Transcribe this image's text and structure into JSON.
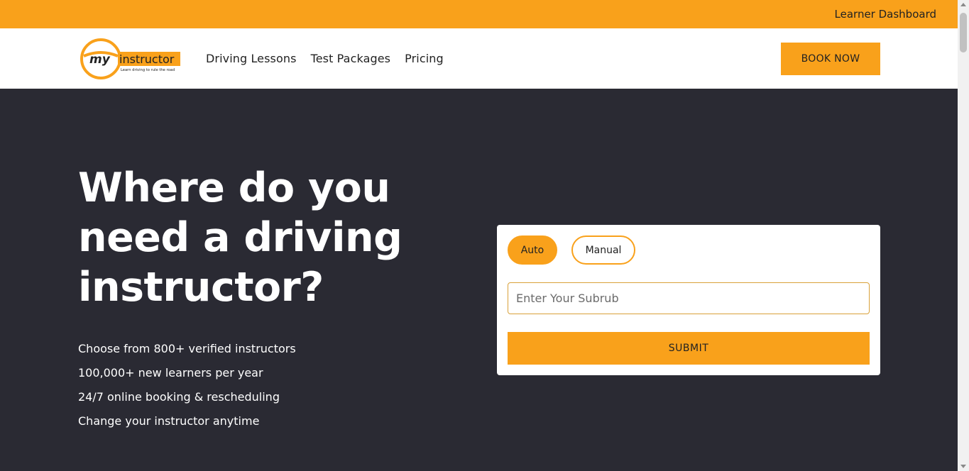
{
  "topbar": {
    "dashboard_link": "Learner Dashboard"
  },
  "brand": {
    "logo_my": "my",
    "logo_name": "instructor",
    "logo_tagline": "Learn driving to rule the road"
  },
  "nav": {
    "items": [
      {
        "label": "Driving Lessons"
      },
      {
        "label": "Test Packages"
      },
      {
        "label": "Pricing"
      }
    ],
    "book_now": "BOOK NOW"
  },
  "hero": {
    "heading": "Where do you need a driving instructor?",
    "features": [
      "Choose from 800+ verified instructors",
      "100,000+ new learners per year",
      "24/7 online booking & rescheduling",
      "Change your instructor anytime"
    ]
  },
  "search_card": {
    "transmission_options": [
      {
        "label": "Auto",
        "selected": true
      },
      {
        "label": "Manual",
        "selected": false
      }
    ],
    "suburb_placeholder": "Enter Your Subrub",
    "suburb_value": "",
    "submit_label": "SUBMIT"
  },
  "colors": {
    "accent": "#f9a11b",
    "hero_bg": "#2a2a33",
    "text_dark": "#222222"
  }
}
